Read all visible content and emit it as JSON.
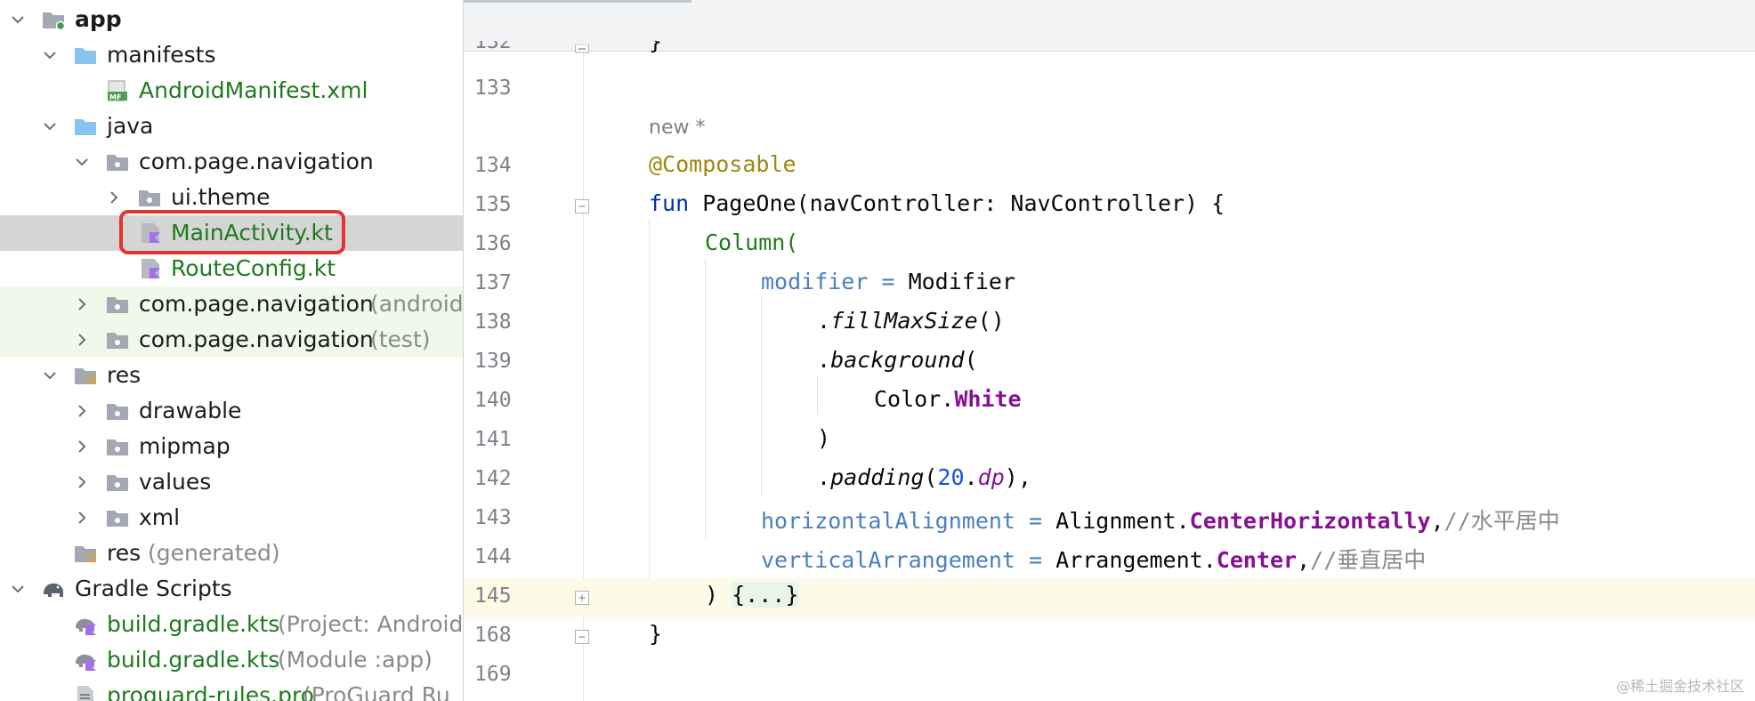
{
  "project_tree": {
    "rows": [
      {
        "label": "app",
        "suffix": "",
        "icon": "module-folder-icon"
      },
      {
        "label": "manifests",
        "suffix": "",
        "icon": "folder-icon"
      },
      {
        "label": "AndroidManifest.xml",
        "suffix": "",
        "icon": "manifest-file-icon"
      },
      {
        "label": "java",
        "suffix": "",
        "icon": "folder-icon"
      },
      {
        "label": "com.page.navigation",
        "suffix": "",
        "icon": "package-icon"
      },
      {
        "label": "ui.theme",
        "suffix": "",
        "icon": "package-icon"
      },
      {
        "label": "MainActivity.kt",
        "suffix": "",
        "icon": "kotlin-file-icon"
      },
      {
        "label": "RouteConfig.kt",
        "suffix": "",
        "icon": "kotlin-file-icon"
      },
      {
        "label": "com.page.navigation",
        "suffix": "(androidT",
        "icon": "package-icon"
      },
      {
        "label": "com.page.navigation",
        "suffix": "(test)",
        "icon": "package-icon"
      },
      {
        "label": "res",
        "suffix": "",
        "icon": "resource-folder-icon"
      },
      {
        "label": "drawable",
        "suffix": "",
        "icon": "package-icon"
      },
      {
        "label": "mipmap",
        "suffix": "",
        "icon": "package-icon"
      },
      {
        "label": "values",
        "suffix": "",
        "icon": "package-icon"
      },
      {
        "label": "xml",
        "suffix": "",
        "icon": "package-icon"
      },
      {
        "label": "res",
        "suffix": "(generated)",
        "icon": "resource-folder-icon"
      },
      {
        "label": "Gradle Scripts",
        "suffix": "",
        "icon": "gradle-elephant-icon"
      },
      {
        "label": "build.gradle.kts",
        "suffix": "(Project: Android",
        "icon": "gradle-file-icon"
      },
      {
        "label": "build.gradle.kts",
        "suffix": "(Module :app)",
        "icon": "gradle-file-icon"
      },
      {
        "label": "proguard-rules.pro",
        "suffix": "(ProGuard Ru",
        "icon": "text-file-icon"
      }
    ]
  },
  "editor": {
    "inlay_hint": "new *",
    "lines": [
      {
        "number": "133"
      },
      {
        "number": "134"
      },
      {
        "number": "135"
      },
      {
        "number": "136"
      },
      {
        "number": "137"
      },
      {
        "number": "138"
      },
      {
        "number": "139"
      },
      {
        "number": "140"
      },
      {
        "number": "141"
      },
      {
        "number": "142"
      },
      {
        "number": "143"
      },
      {
        "number": "144"
      },
      {
        "number": "145"
      },
      {
        "number": "168"
      },
      {
        "number": "169"
      }
    ],
    "tokens": {
      "t1": "}",
      "t2": "@Composable",
      "t3": "fun",
      "t4": " PageOne(navController: NavController) {",
      "t5": "Column(",
      "t6": "modifier",
      "t7": " = ",
      "t8": "Modifier",
      "t9": ".",
      "t10": "fillMaxSize",
      "t11": "()",
      "t12": ".",
      "t13": "background",
      "t14": "(",
      "t15": "Color.",
      "t16": "White",
      "t17": ")",
      "t18": ".",
      "t19": "padding",
      "t20": "(",
      "t21": "20",
      "t22": ".",
      "t23": "dp",
      "t24": "),",
      "t25": "horizontalAlignment",
      "t26": " = ",
      "t27": "Alignment.",
      "t28": "CenterHorizontally",
      "t29": ",",
      "t30": "//水平居中",
      "t31": "verticalArrangement",
      "t32": " = ",
      "t33": "Arrangement.",
      "t34": "Center",
      "t35": ",",
      "t36": "//垂直居中",
      "t37": ") ",
      "t38": "{...}",
      "t39": "}"
    }
  },
  "watermark": "@稀土掘金技术社区"
}
